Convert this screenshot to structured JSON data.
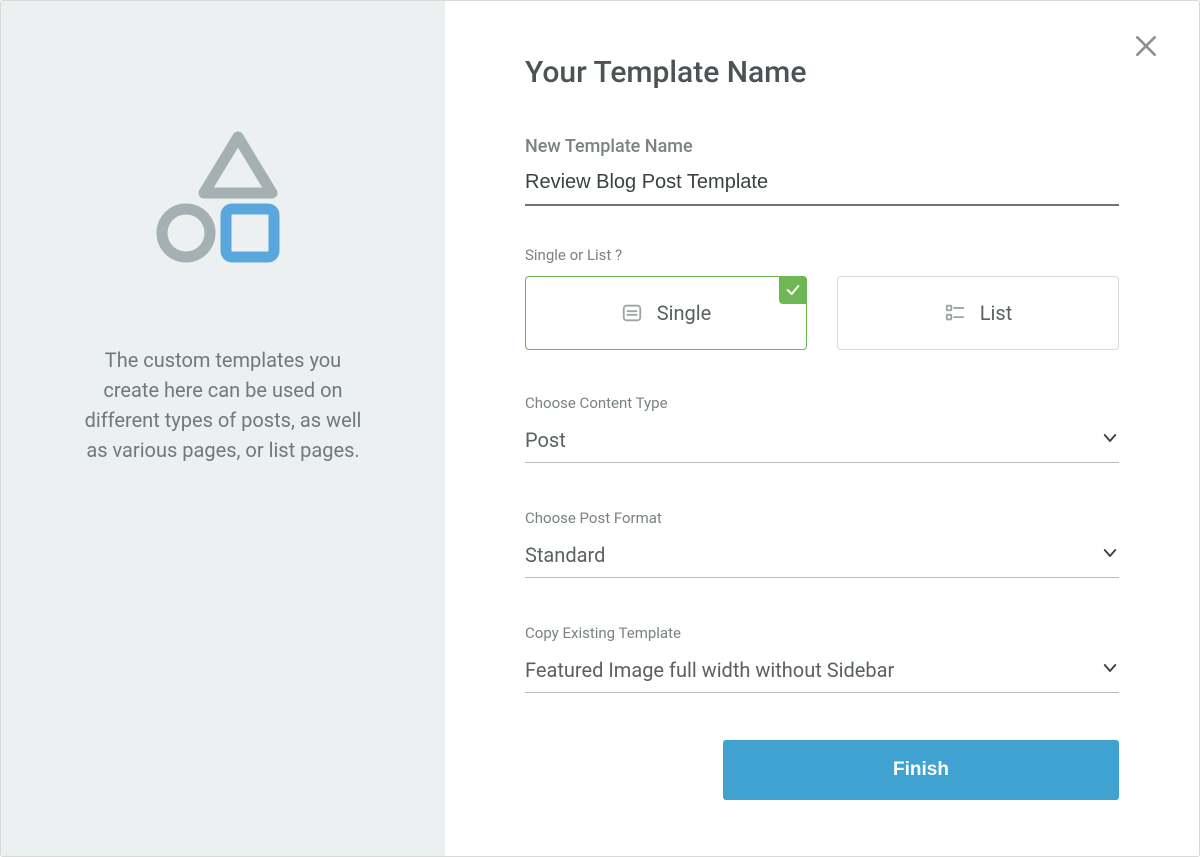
{
  "sidebar": {
    "description": "The custom templates you create here can be used on different types of posts, as well as various pages, or list pages."
  },
  "header": {
    "title": "Your Template Name"
  },
  "form": {
    "name": {
      "label": "New Template Name",
      "value": "Review Blog Post Template"
    },
    "mode": {
      "label": "Single or List ?",
      "options": {
        "single": "Single",
        "list": "List"
      },
      "selected": "single"
    },
    "content_type": {
      "label": "Choose Content Type",
      "value": "Post"
    },
    "post_format": {
      "label": "Choose Post Format",
      "value": "Standard"
    },
    "copy_template": {
      "label": "Copy Existing Template",
      "value": "Featured Image full width without Sidebar"
    }
  },
  "actions": {
    "finish": "Finish"
  }
}
